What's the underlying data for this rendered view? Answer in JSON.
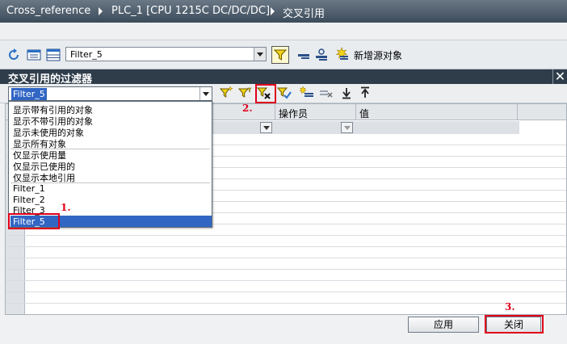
{
  "titlebar": {
    "crumbs": [
      "Cross_reference",
      "PLC_1 [CPU 1215C DC/DC/DC]",
      "交叉引用"
    ]
  },
  "toolbar": {
    "filter_value": "Filter_5",
    "new_source_label": "新增源对象",
    "icons": [
      "refresh-icon",
      "list-icon",
      "table-icon",
      "filter-icon",
      "collapse-icon",
      "tree-icon",
      "new-source-icon"
    ]
  },
  "dialog": {
    "title": "交叉引用的过滤器",
    "close_glyph": "✕",
    "filter_value": "Filter_5",
    "columns": [
      "操作员",
      "值"
    ],
    "dropdown": {
      "group1": [
        "显示带有引用的对象",
        "显示不带引用的对象",
        "显示未使用的对象",
        "显示所有对象"
      ],
      "group2": [
        "仅显示使用量",
        "仅显示已使用的",
        "仅显示本地引用"
      ],
      "group3": [
        "Filter_1",
        "Filter_2",
        "Filter_3",
        "Filter_5"
      ],
      "selected": "Filter_5"
    },
    "buttons": {
      "apply": "应用",
      "close": "关闭"
    }
  },
  "annotations": {
    "step1": "1.",
    "step2": "2.",
    "step3": "3."
  },
  "colors": {
    "annotation": "#e0001a",
    "selection": "#3166c4",
    "titlebar": "#3c4b5a"
  }
}
